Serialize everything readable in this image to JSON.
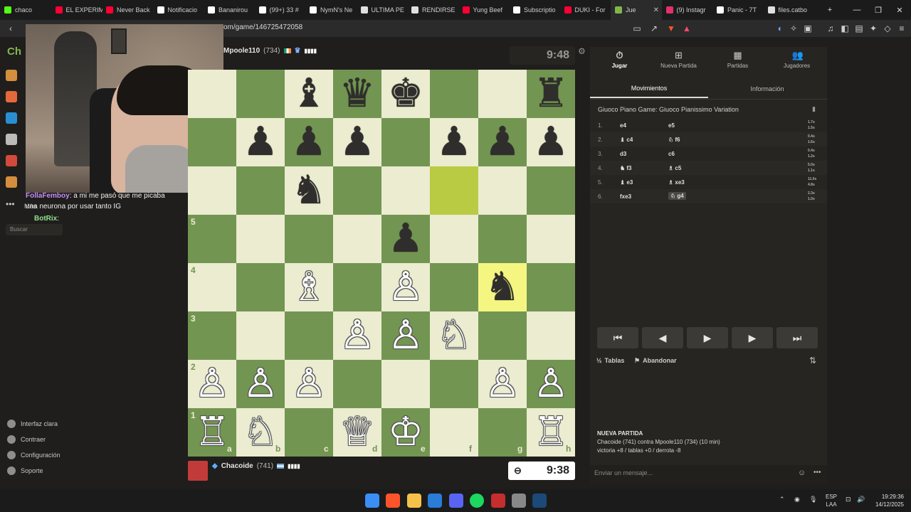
{
  "browser": {
    "tabs": [
      {
        "label": "chaco",
        "color": "#53fc18"
      },
      {
        "label": "EL EXPERIM",
        "color": "#ff0033"
      },
      {
        "label": "Never Back",
        "color": "#ff0033"
      },
      {
        "label": "Notificacio",
        "color": "#ffffff"
      },
      {
        "label": "Bananirou",
        "color": "#ffffff"
      },
      {
        "label": "(99+) 33 #",
        "color": "#ffffff"
      },
      {
        "label": "NymN's Ne",
        "color": "#ffffff"
      },
      {
        "label": "ULTIMA PE",
        "color": "#e0e0e0"
      },
      {
        "label": "RENDIRSE",
        "color": "#e0e0e0"
      },
      {
        "label": "Yung Beef",
        "color": "#ff0033"
      },
      {
        "label": "Subscriptio",
        "color": "#ffffff"
      },
      {
        "label": "DUKI - For",
        "color": "#ff0033"
      },
      {
        "label": "Jue",
        "color": "#81b64c",
        "active": true
      },
      {
        "label": "(9) Instagr",
        "color": "#e1306c"
      },
      {
        "label": "Panic - 7T",
        "color": "#ffffff"
      },
      {
        "label": "files.catbo",
        "color": "#e0e0e0"
      }
    ],
    "url": "om/game/146725472058"
  },
  "leftnav": {
    "logo_text": "Ch",
    "bottom_links": [
      "Interfaz clara",
      "Contraer",
      "Configuración",
      "Soporte"
    ],
    "more_label": "Más",
    "search_placeholder": "Buscar"
  },
  "chat": {
    "line1_user": "FollaFemboy",
    "line1_text": ": a mi me pasó que me picaba una neurona por usar tanto IG",
    "line2_user": "BotRix",
    "line2_text": ":"
  },
  "game": {
    "top_player": {
      "name": "Mpoole110",
      "rating": "(734)",
      "clock": "9:48"
    },
    "bottom_player": {
      "name": "Chacoide",
      "rating": "(741)",
      "clock": "9:38"
    },
    "files": [
      "a",
      "b",
      "c",
      "d",
      "e",
      "f",
      "g",
      "h"
    ],
    "ranks_shown": [
      "5",
      "4",
      "3",
      "2",
      "1"
    ],
    "pieces": [
      {
        "sq": "c8",
        "p": "♝",
        "c": "b"
      },
      {
        "sq": "d8",
        "p": "♛",
        "c": "b"
      },
      {
        "sq": "e8",
        "p": "♚",
        "c": "b"
      },
      {
        "sq": "h8",
        "p": "♜",
        "c": "b"
      },
      {
        "sq": "b7",
        "p": "♟",
        "c": "b"
      },
      {
        "sq": "c7",
        "p": "♟",
        "c": "b"
      },
      {
        "sq": "d7",
        "p": "♟",
        "c": "b"
      },
      {
        "sq": "f7",
        "p": "♟",
        "c": "b"
      },
      {
        "sq": "g7",
        "p": "♟",
        "c": "b"
      },
      {
        "sq": "h7",
        "p": "♟",
        "c": "b"
      },
      {
        "sq": "c6",
        "p": "♞",
        "c": "b"
      },
      {
        "sq": "e5",
        "p": "♟",
        "c": "b"
      },
      {
        "sq": "c4",
        "p": "♗",
        "c": "w"
      },
      {
        "sq": "e4",
        "p": "♙",
        "c": "w"
      },
      {
        "sq": "g4",
        "p": "♞",
        "c": "b"
      },
      {
        "sq": "d3",
        "p": "♙",
        "c": "w"
      },
      {
        "sq": "e3",
        "p": "♙",
        "c": "w"
      },
      {
        "sq": "f3",
        "p": "♘",
        "c": "w"
      },
      {
        "sq": "a2",
        "p": "♙",
        "c": "w"
      },
      {
        "sq": "b2",
        "p": "♙",
        "c": "w"
      },
      {
        "sq": "c2",
        "p": "♙",
        "c": "w"
      },
      {
        "sq": "g2",
        "p": "♙",
        "c": "w"
      },
      {
        "sq": "h2",
        "p": "♙",
        "c": "w"
      },
      {
        "sq": "a1",
        "p": "♖",
        "c": "w"
      },
      {
        "sq": "b1",
        "p": "♘",
        "c": "w"
      },
      {
        "sq": "d1",
        "p": "♕",
        "c": "w"
      },
      {
        "sq": "e1",
        "p": "♔",
        "c": "w"
      },
      {
        "sq": "h1",
        "p": "♖",
        "c": "w"
      }
    ],
    "highlights": [
      "f6",
      "g4"
    ]
  },
  "panel": {
    "tabs": [
      {
        "label": "Jugar",
        "icon": "stopwatch-icon",
        "glyph": "⏱"
      },
      {
        "label": "Nueva Partida",
        "icon": "plus-icon",
        "glyph": "⊞"
      },
      {
        "label": "Partidas",
        "icon": "board-icon",
        "glyph": "▦"
      },
      {
        "label": "Jugadores",
        "icon": "players-icon",
        "glyph": "👥"
      }
    ],
    "subtabs": [
      "Movimientos",
      "Información"
    ],
    "opening": "Giuoco Piano Game: Giuoco Pianissimo Variation",
    "moves": [
      {
        "n": "1.",
        "w": "e4",
        "b": "e5",
        "tw": "1.7s",
        "tb": "1.5s"
      },
      {
        "n": "2.",
        "w": "♝ c4",
        "b": "♘ f6",
        "tw": "0.4s",
        "tb": "1.6s"
      },
      {
        "n": "3.",
        "w": "d3",
        "b": "c6",
        "tw": "0.4s",
        "tb": "1.2s"
      },
      {
        "n": "4.",
        "w": "♞ f3",
        "b": "♗ c5",
        "tw": "5.0s",
        "tb": "1.1s"
      },
      {
        "n": "5.",
        "w": "♝ e3",
        "b": "♗ xe3",
        "tw": "11.0s",
        "tb": "4.8s"
      },
      {
        "n": "6.",
        "w": "fxe3",
        "b": "♘ g4",
        "tw": "2.3s",
        "tb": "1.0s"
      }
    ],
    "nav_buttons": [
      "⏮",
      "◀",
      "▶",
      "▶",
      "⏭"
    ],
    "draw_label": "Tablas",
    "resign_label": "Abandonar",
    "new_game_title": "NUEVA PARTIDA",
    "new_game_line": "Chacoide (741) contra Mpoole110 (734) (10 min)",
    "new_game_stats": "victoria +8 / tablas +0 / derrota -8",
    "message_placeholder": "Enviar un mensaje..."
  },
  "taskbar": {
    "lang": "ESP",
    "lang2": "LAA",
    "time": "19:29:36",
    "date": "14/12/2025"
  }
}
